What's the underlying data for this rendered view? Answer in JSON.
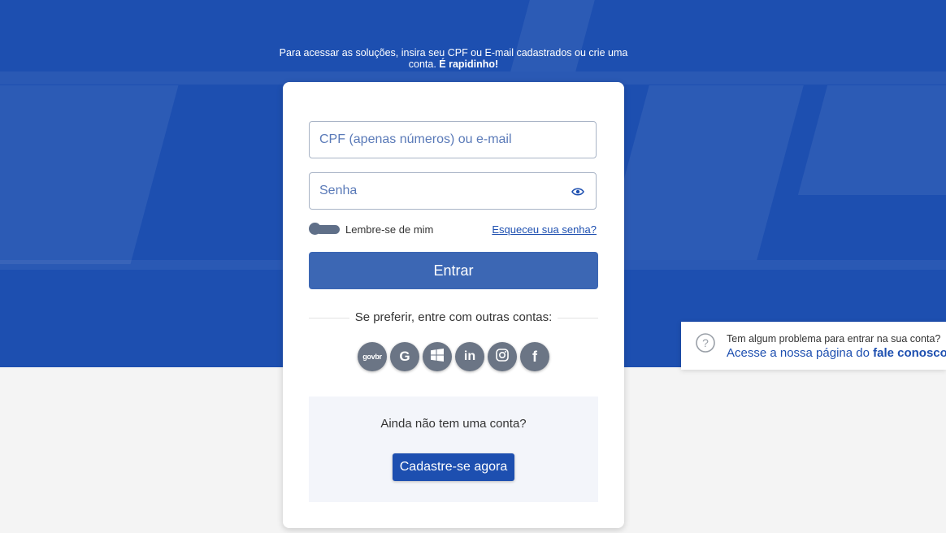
{
  "intro": {
    "text": "Para acessar as soluções, insira seu CPF ou E-mail cadastrados ou crie uma conta. ",
    "emphasis": "É rapidinho!"
  },
  "login": {
    "user_placeholder": "CPF (apenas números) ou e-mail",
    "password_placeholder": "Senha",
    "remember_label": "Lembre-se de mim",
    "remember_on": false,
    "forgot_label": "Esqueceu sua senha?",
    "submit_label": "Entrar"
  },
  "social": {
    "heading": "Se preferir, entre com outras contas:",
    "providers": [
      "gov.br",
      "Google",
      "Microsoft",
      "LinkedIn",
      "Instagram",
      "Facebook"
    ],
    "govbr_mark": "govbr",
    "google_mark": "G",
    "linkedin_mark": "in",
    "facebook_mark": "f"
  },
  "signup": {
    "question": "Ainda não tem uma conta?",
    "button_label": "Cadastre-se agora"
  },
  "help": {
    "line1": "Tem algum problema para entrar na sua conta?",
    "line2_prefix": "Acesse a nossa página do ",
    "link_label": "fale conosco"
  },
  "colors": {
    "brand_blue": "#1d4fb0",
    "button_blue": "#3c67b4",
    "social_gray": "#6b7585",
    "page_bg": "#f4f4f4"
  },
  "icons": {
    "password_toggle": "eye-icon",
    "help": "question-circle-icon"
  }
}
